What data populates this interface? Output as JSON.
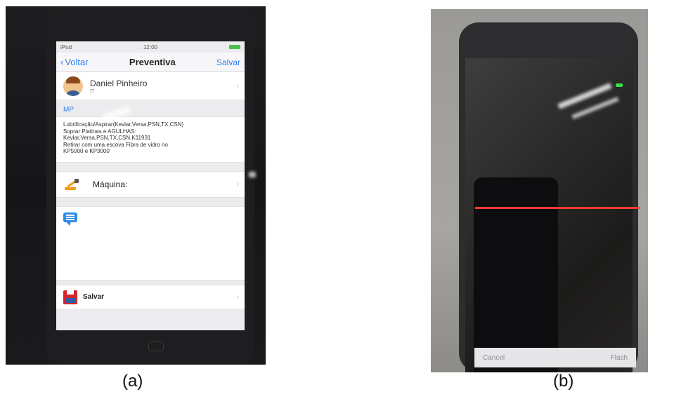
{
  "figure_a": {
    "caption": "(a)",
    "status_bar": {
      "left": "iPod",
      "time": "12:00"
    },
    "nav": {
      "back_label": "Voltar",
      "title": "Preventiva",
      "save_label": "Salvar"
    },
    "user": {
      "name": "Daniel Pinheiro",
      "subtitle": "IT"
    },
    "section_header": "MP",
    "maintenance_text": [
      "Lubrificação/Aspirar(Kevlar,Versa,PSN,TX,CSN)",
      "Soprar Platinas e AGULHAS:",
      "Kevlar,Versa,PSN,TX,CSN,K11931",
      "Retirar com uma escova Fibra de vidro no",
      "KP5000 e KP3000"
    ],
    "machine_label": "Máquina:",
    "save_row_label": "Salvar",
    "icons": {
      "back": "chevron-left-icon",
      "avatar": "user-avatar-icon",
      "machine": "robot-arm-icon",
      "comment": "comment-bubble-icon",
      "save": "floppy-disk-icon",
      "disclosure": "chevron-right-icon"
    },
    "colors": {
      "accent": "#2f7ef0",
      "robot": "#f29b1d",
      "floppy": "#d8232a"
    }
  },
  "figure_b": {
    "caption": "(b)",
    "scanner": {
      "cancel_label": "Cancel",
      "flash_label": "Flash"
    },
    "colors": {
      "scan_line": "#ff3b30",
      "led": "#39e04a"
    }
  }
}
